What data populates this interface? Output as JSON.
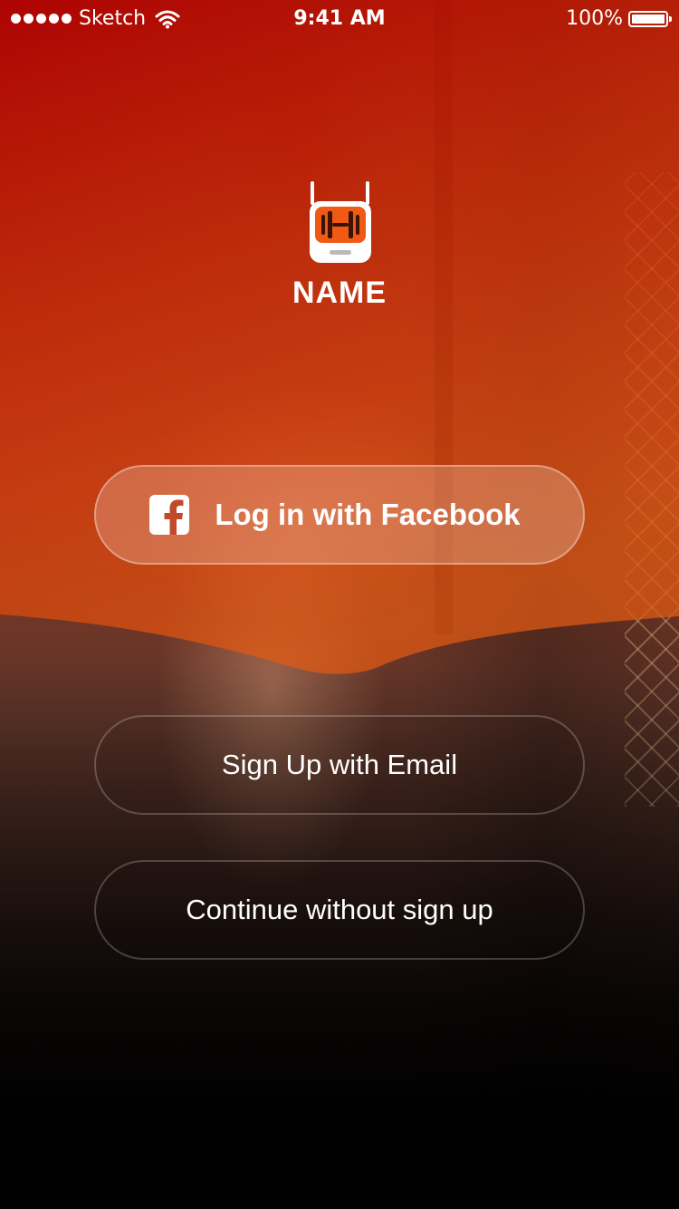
{
  "status_bar": {
    "carrier": "Sketch",
    "time": "9:41 AM",
    "battery": "100%",
    "signal_bars": 5,
    "icons": [
      "signal-dots-icon",
      "wifi-icon",
      "battery-icon"
    ]
  },
  "app": {
    "name": "NAME",
    "logo_icon": "dumbbell-radio-icon"
  },
  "buttons": {
    "facebook_label": "Log in with Facebook",
    "facebook_icon": "facebook-icon",
    "email_label": "Sign Up with Email",
    "continue_label": "Continue without sign up"
  },
  "colors": {
    "overlay_red": "#c81e00",
    "overlay_orange": "#e8521a",
    "logo_orange": "#f05a14",
    "text": "#ffffff"
  }
}
